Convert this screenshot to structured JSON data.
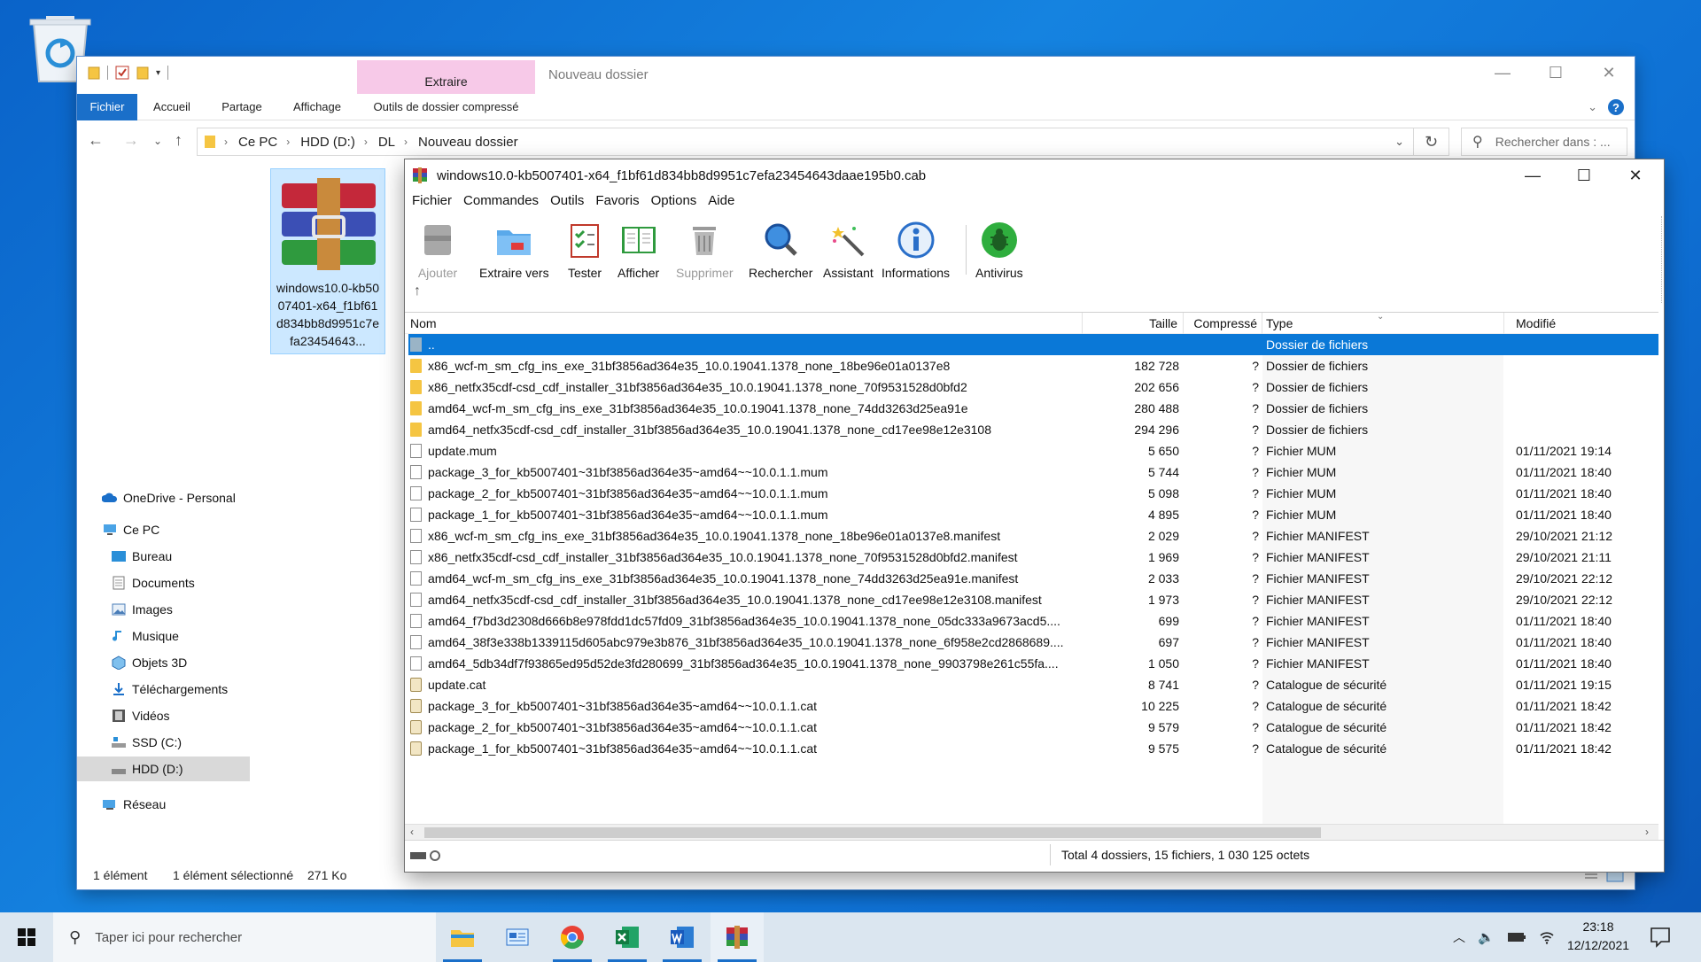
{
  "explorer": {
    "title": "Nouveau dossier",
    "context_tab": "Extraire",
    "ribbon_tabs": [
      "Fichier",
      "Accueil",
      "Partage",
      "Affichage",
      "Outils de dossier compressé"
    ],
    "breadcrumb": [
      "Ce PC",
      "HDD (D:)",
      "DL",
      "Nouveau dossier"
    ],
    "search_placeholder": "Rechercher dans : ...",
    "nav": {
      "onedrive": "OneDrive - Personal",
      "this_pc": "Ce PC",
      "items": [
        "Bureau",
        "Documents",
        "Images",
        "Musique",
        "Objets 3D",
        "Téléchargements",
        "Vidéos",
        "SSD (C:)",
        "HDD (D:)"
      ],
      "network": "Réseau"
    },
    "file_tile_name": "windows10.0-kb5007401-x64_f1bf61d834bb8d9951c7efa23454643...",
    "status": {
      "count": "1 élément",
      "selected": "1 élément sélectionné",
      "size": "271 Ko"
    }
  },
  "winrar": {
    "title": "windows10.0-kb5007401-x64_f1bf61d834bb8d9951c7efa23454643daae195b0.cab",
    "menu": [
      "Fichier",
      "Commandes",
      "Outils",
      "Favoris",
      "Options",
      "Aide"
    ],
    "toolbar": {
      "add": "Ajouter",
      "extract": "Extraire vers",
      "test": "Tester",
      "view": "Afficher",
      "delete": "Supprimer",
      "find": "Rechercher",
      "wizard": "Assistant",
      "info": "Informations",
      "antivirus": "Antivirus"
    },
    "columns": {
      "name": "Nom",
      "size": "Taille",
      "packed": "Compressé",
      "type": "Type",
      "modified": "Modifié"
    },
    "rows": [
      {
        "name": "..",
        "size": "",
        "packed": "",
        "type": "Dossier de fichiers",
        "modified": ""
      },
      {
        "name": "x86_wcf-m_sm_cfg_ins_exe_31bf3856ad364e35_10.0.19041.1378_none_18be96e01a0137e8",
        "size": "182 728",
        "packed": "?",
        "type": "Dossier de fichiers",
        "modified": ""
      },
      {
        "name": "x86_netfx35cdf-csd_cdf_installer_31bf3856ad364e35_10.0.19041.1378_none_70f9531528d0bfd2",
        "size": "202 656",
        "packed": "?",
        "type": "Dossier de fichiers",
        "modified": ""
      },
      {
        "name": "amd64_wcf-m_sm_cfg_ins_exe_31bf3856ad364e35_10.0.19041.1378_none_74dd3263d25ea91e",
        "size": "280 488",
        "packed": "?",
        "type": "Dossier de fichiers",
        "modified": ""
      },
      {
        "name": "amd64_netfx35cdf-csd_cdf_installer_31bf3856ad364e35_10.0.19041.1378_none_cd17ee98e12e3108",
        "size": "294 296",
        "packed": "?",
        "type": "Dossier de fichiers",
        "modified": ""
      },
      {
        "name": "update.mum",
        "size": "5 650",
        "packed": "?",
        "type": "Fichier MUM",
        "modified": "01/11/2021 19:14"
      },
      {
        "name": "package_3_for_kb5007401~31bf3856ad364e35~amd64~~10.0.1.1.mum",
        "size": "5 744",
        "packed": "?",
        "type": "Fichier MUM",
        "modified": "01/11/2021 18:40"
      },
      {
        "name": "package_2_for_kb5007401~31bf3856ad364e35~amd64~~10.0.1.1.mum",
        "size": "5 098",
        "packed": "?",
        "type": "Fichier MUM",
        "modified": "01/11/2021 18:40"
      },
      {
        "name": "package_1_for_kb5007401~31bf3856ad364e35~amd64~~10.0.1.1.mum",
        "size": "4 895",
        "packed": "?",
        "type": "Fichier MUM",
        "modified": "01/11/2021 18:40"
      },
      {
        "name": "x86_wcf-m_sm_cfg_ins_exe_31bf3856ad364e35_10.0.19041.1378_none_18be96e01a0137e8.manifest",
        "size": "2 029",
        "packed": "?",
        "type": "Fichier MANIFEST",
        "modified": "29/10/2021 21:12"
      },
      {
        "name": "x86_netfx35cdf-csd_cdf_installer_31bf3856ad364e35_10.0.19041.1378_none_70f9531528d0bfd2.manifest",
        "size": "1 969",
        "packed": "?",
        "type": "Fichier MANIFEST",
        "modified": "29/10/2021 21:11"
      },
      {
        "name": "amd64_wcf-m_sm_cfg_ins_exe_31bf3856ad364e35_10.0.19041.1378_none_74dd3263d25ea91e.manifest",
        "size": "2 033",
        "packed": "?",
        "type": "Fichier MANIFEST",
        "modified": "29/10/2021 22:12"
      },
      {
        "name": "amd64_netfx35cdf-csd_cdf_installer_31bf3856ad364e35_10.0.19041.1378_none_cd17ee98e12e3108.manifest",
        "size": "1 973",
        "packed": "?",
        "type": "Fichier MANIFEST",
        "modified": "29/10/2021 22:12"
      },
      {
        "name": "amd64_f7bd3d2308d666b8e978fdd1dc57fd09_31bf3856ad364e35_10.0.19041.1378_none_05dc333a9673acd5....",
        "size": "699",
        "packed": "?",
        "type": "Fichier MANIFEST",
        "modified": "01/11/2021 18:40"
      },
      {
        "name": "amd64_38f3e338b1339115d605abc979e3b876_31bf3856ad364e35_10.0.19041.1378_none_6f958e2cd2868689....",
        "size": "697",
        "packed": "?",
        "type": "Fichier MANIFEST",
        "modified": "01/11/2021 18:40"
      },
      {
        "name": "amd64_5db34df7f93865ed95d52de3fd280699_31bf3856ad364e35_10.0.19041.1378_none_9903798e261c55fa....",
        "size": "1 050",
        "packed": "?",
        "type": "Fichier MANIFEST",
        "modified": "01/11/2021 18:40"
      },
      {
        "name": "update.cat",
        "size": "8 741",
        "packed": "?",
        "type": "Catalogue de sécurité",
        "modified": "01/11/2021 19:15"
      },
      {
        "name": "package_3_for_kb5007401~31bf3856ad364e35~amd64~~10.0.1.1.cat",
        "size": "10 225",
        "packed": "?",
        "type": "Catalogue de sécurité",
        "modified": "01/11/2021 18:42"
      },
      {
        "name": "package_2_for_kb5007401~31bf3856ad364e35~amd64~~10.0.1.1.cat",
        "size": "9 579",
        "packed": "?",
        "type": "Catalogue de sécurité",
        "modified": "01/11/2021 18:42"
      },
      {
        "name": "package_1_for_kb5007401~31bf3856ad364e35~amd64~~10.0.1.1.cat",
        "size": "9 575",
        "packed": "?",
        "type": "Catalogue de sécurité",
        "modified": "01/11/2021 18:42"
      }
    ],
    "status_total": "Total 4 dossiers, 15 fichiers, 1 030 125 octets"
  },
  "taskbar": {
    "search_placeholder": "Taper ici pour rechercher",
    "time": "23:18",
    "date": "12/12/2021"
  },
  "colors": {
    "accent": "#1a6fc9",
    "selection": "#0a78d7",
    "context_tab": "#f7c9e8"
  }
}
